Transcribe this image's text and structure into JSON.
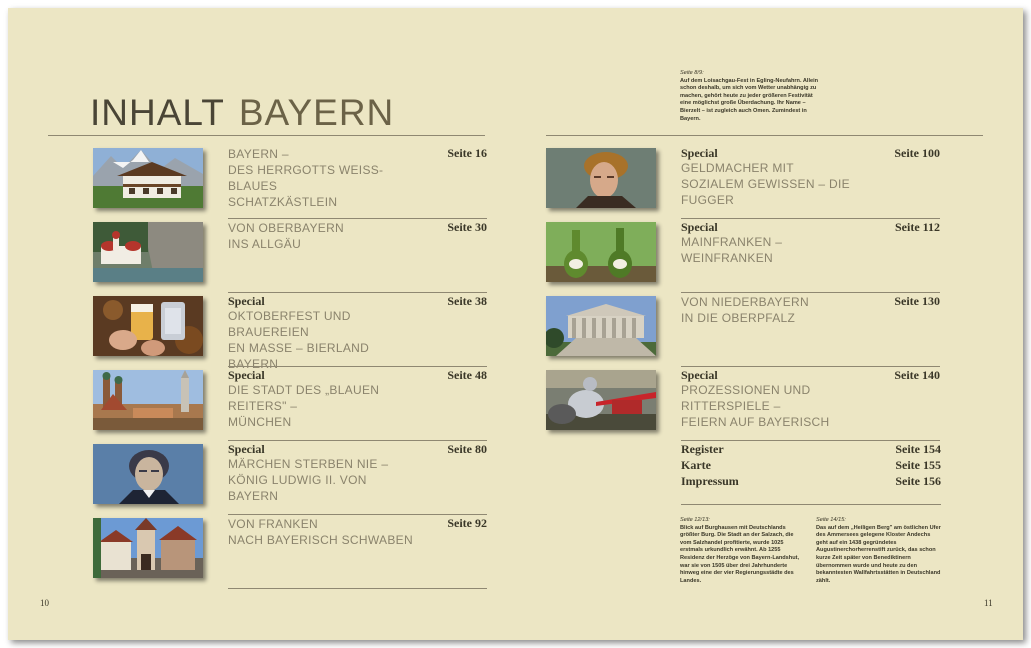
{
  "heading": {
    "part1": "INHALT",
    "part2": "BAYERN"
  },
  "caption_top": {
    "ref": "Seite 8/9:",
    "text": "Auf dem Loisachgau-Fest in Egling-Neufahrn. Allein schon deshalb, um sich vom Wetter unabhängig zu machen, gehört heute zu jeder größeren Festivität eine möglichst große Überdachung. Ihr Name – Bierzelt – ist zugleich auch Omen. Zumindest in Bayern."
  },
  "left_entries": [
    {
      "special": "",
      "lines": [
        "BAYERN –",
        "DES HERRGOTTS WEISS-BLAUES",
        "SCHATZKÄSTLEIN"
      ],
      "page": "Seite 16",
      "image": "alpine-house"
    },
    {
      "special": "",
      "lines": [
        "VON OBERBAYERN",
        "INS ALLGÄU"
      ],
      "page": "Seite 30",
      "image": "lake-chapel"
    },
    {
      "special": "Special",
      "lines": [
        "OKTOBERFEST UND BRAUEREIEN",
        "EN MASSE – BIERLAND BAYERN"
      ],
      "page": "Seite 38",
      "image": "beer-mugs"
    },
    {
      "special": "Special",
      "lines": [
        "DIE STADT DES „BLAUEN REITERS\" –",
        "MÜNCHEN"
      ],
      "page": "Seite 48",
      "image": "munich-skyline"
    },
    {
      "special": "Special",
      "lines": [
        "MÄRCHEN STERBEN NIE –",
        "KÖNIG LUDWIG II. VON BAYERN"
      ],
      "page": "Seite 80",
      "image": "ludwig-portrait"
    },
    {
      "special": "",
      "lines": [
        "VON FRANKEN",
        "NACH BAYERISCH SCHWABEN"
      ],
      "page": "Seite 92",
      "image": "franconian-gate"
    }
  ],
  "right_entries": [
    {
      "special": "Special",
      "lines": [
        "GELDMACHER MIT",
        "SOZIALEM GEWISSEN – DIE FUGGER"
      ],
      "page": "Seite 100",
      "image": "fugger-portrait"
    },
    {
      "special": "Special",
      "lines": [
        "MAINFRANKEN –",
        "WEINFRANKEN"
      ],
      "page": "Seite 112",
      "image": "wine-bottles"
    },
    {
      "special": "",
      "lines": [
        "VON NIEDERBAYERN",
        "IN DIE OBERPFALZ"
      ],
      "page": "Seite 130",
      "image": "walhalla-temple"
    },
    {
      "special": "Special",
      "lines": [
        "PROZESSIONEN UND RITTERSPIELE –",
        "FEIERN AUF BAYERISCH"
      ],
      "page": "Seite 140",
      "image": "knights-tournament"
    }
  ],
  "misc": [
    {
      "label": "Register",
      "page": "Seite 154"
    },
    {
      "label": "Karte",
      "page": "Seite 155"
    },
    {
      "label": "Impressum",
      "page": "Seite 156"
    }
  ],
  "captions_bottom": [
    {
      "ref": "Seite 12/13:",
      "text": "Blick auf Burghausen mit Deutschlands größter Burg. Die Stadt an der Salzach, die vom Salzhandel profitierte, wurde 1025 erstmals urkundlich erwähnt. Ab 1255 Residenz der Herzöge von Bayern-Landshut, war sie von 1505 über drei Jahrhunderte hinweg eine der vier Regierungsstädte des Landes."
    },
    {
      "ref": "Seite 14/15:",
      "text": "Das auf dem „Heiligen Berg\" am östlichen Ufer des Ammersees gelegene Kloster Andechs geht auf ein 1438 gegründetes Augustinerchorherrenstift zurück, das schon kurze Zeit später von Benediktinern übernommen wurde und heute zu den bekanntesten Wallfahrtsstätten in Deutschland zählt."
    }
  ],
  "folio": {
    "left": "10",
    "right": "11"
  },
  "colors": {
    "page": "#ece6c4",
    "heading": "#4a4536",
    "entry_text": "#8a836c",
    "rule": "#8f8872"
  }
}
